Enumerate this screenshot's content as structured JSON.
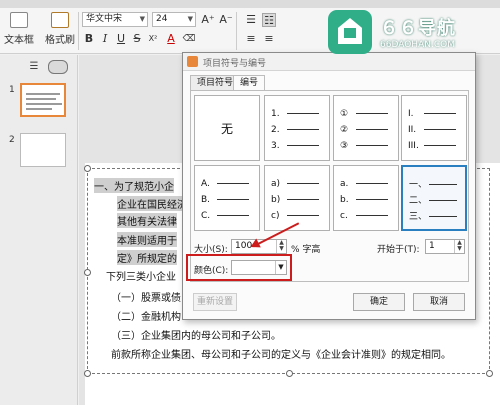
{
  "toolbar": {
    "text_box_label": "文本框",
    "format_brush_label": "格式刷",
    "font_name": "华文中宋",
    "font_size": "24",
    "grow_font": "A⁺",
    "shrink_font": "A⁻",
    "bold": "B",
    "italic": "I",
    "underline": "U",
    "strike": "S",
    "superscript": "X²",
    "font_color": "A",
    "clear_format": "⌫"
  },
  "left_panel": {
    "tab_outline_icon": "outline-icon",
    "tab_slides_icon": "slides-icon",
    "slides": [
      {
        "number": "1",
        "selected": true
      },
      {
        "number": "2",
        "selected": false
      }
    ]
  },
  "slide": {
    "paragraphs": [
      "一、为了规范小企",
      "企业在国民经济",
      "其他有关法律",
      "本准则适用于",
      "定》所规定的",
      "下列三类小企业",
      "（一）股票或债",
      "（二）金融机构",
      "（三）企业集团内的母公司和子公司。",
      "前款所称企业集团、母公司和子公司的定义与《企业会计准则》的规定相同。"
    ]
  },
  "dialog": {
    "title": "项目符号与编号",
    "tabs": [
      "项目符号",
      "编号"
    ],
    "active_tab": "编号",
    "cells": [
      {
        "type": "none",
        "label": "无"
      },
      {
        "type": "list",
        "markers": [
          "1.",
          "2.",
          "3."
        ]
      },
      {
        "type": "list",
        "markers": [
          "①",
          "②",
          "③"
        ]
      },
      {
        "type": "list",
        "markers": [
          "I.",
          "II.",
          "III."
        ]
      },
      {
        "type": "list",
        "markers": [
          "A.",
          "B.",
          "C."
        ]
      },
      {
        "type": "list",
        "markers": [
          "a)",
          "b)",
          "c)"
        ]
      },
      {
        "type": "list",
        "markers": [
          "a.",
          "b.",
          "c."
        ]
      },
      {
        "type": "list",
        "markers": [
          "一、",
          "二、",
          "三、"
        ],
        "selected": true
      }
    ],
    "size_label": "大小(S):",
    "size_value": "100",
    "size_unit": "% 字高",
    "start_label": "开始于(T):",
    "start_value": "1",
    "color_label": "颜色(C):",
    "color_value": "",
    "reset_button": "重新设置",
    "ok_button": "确定",
    "cancel_button": "取消"
  },
  "watermark": {
    "title": "６６导航",
    "domain": "66DAOHAN.COM"
  },
  "colors": {
    "accent": "#e8873a",
    "selection": "#2a7fc1",
    "annotation": "#cc1c1c",
    "watermark": "#2fae88"
  }
}
